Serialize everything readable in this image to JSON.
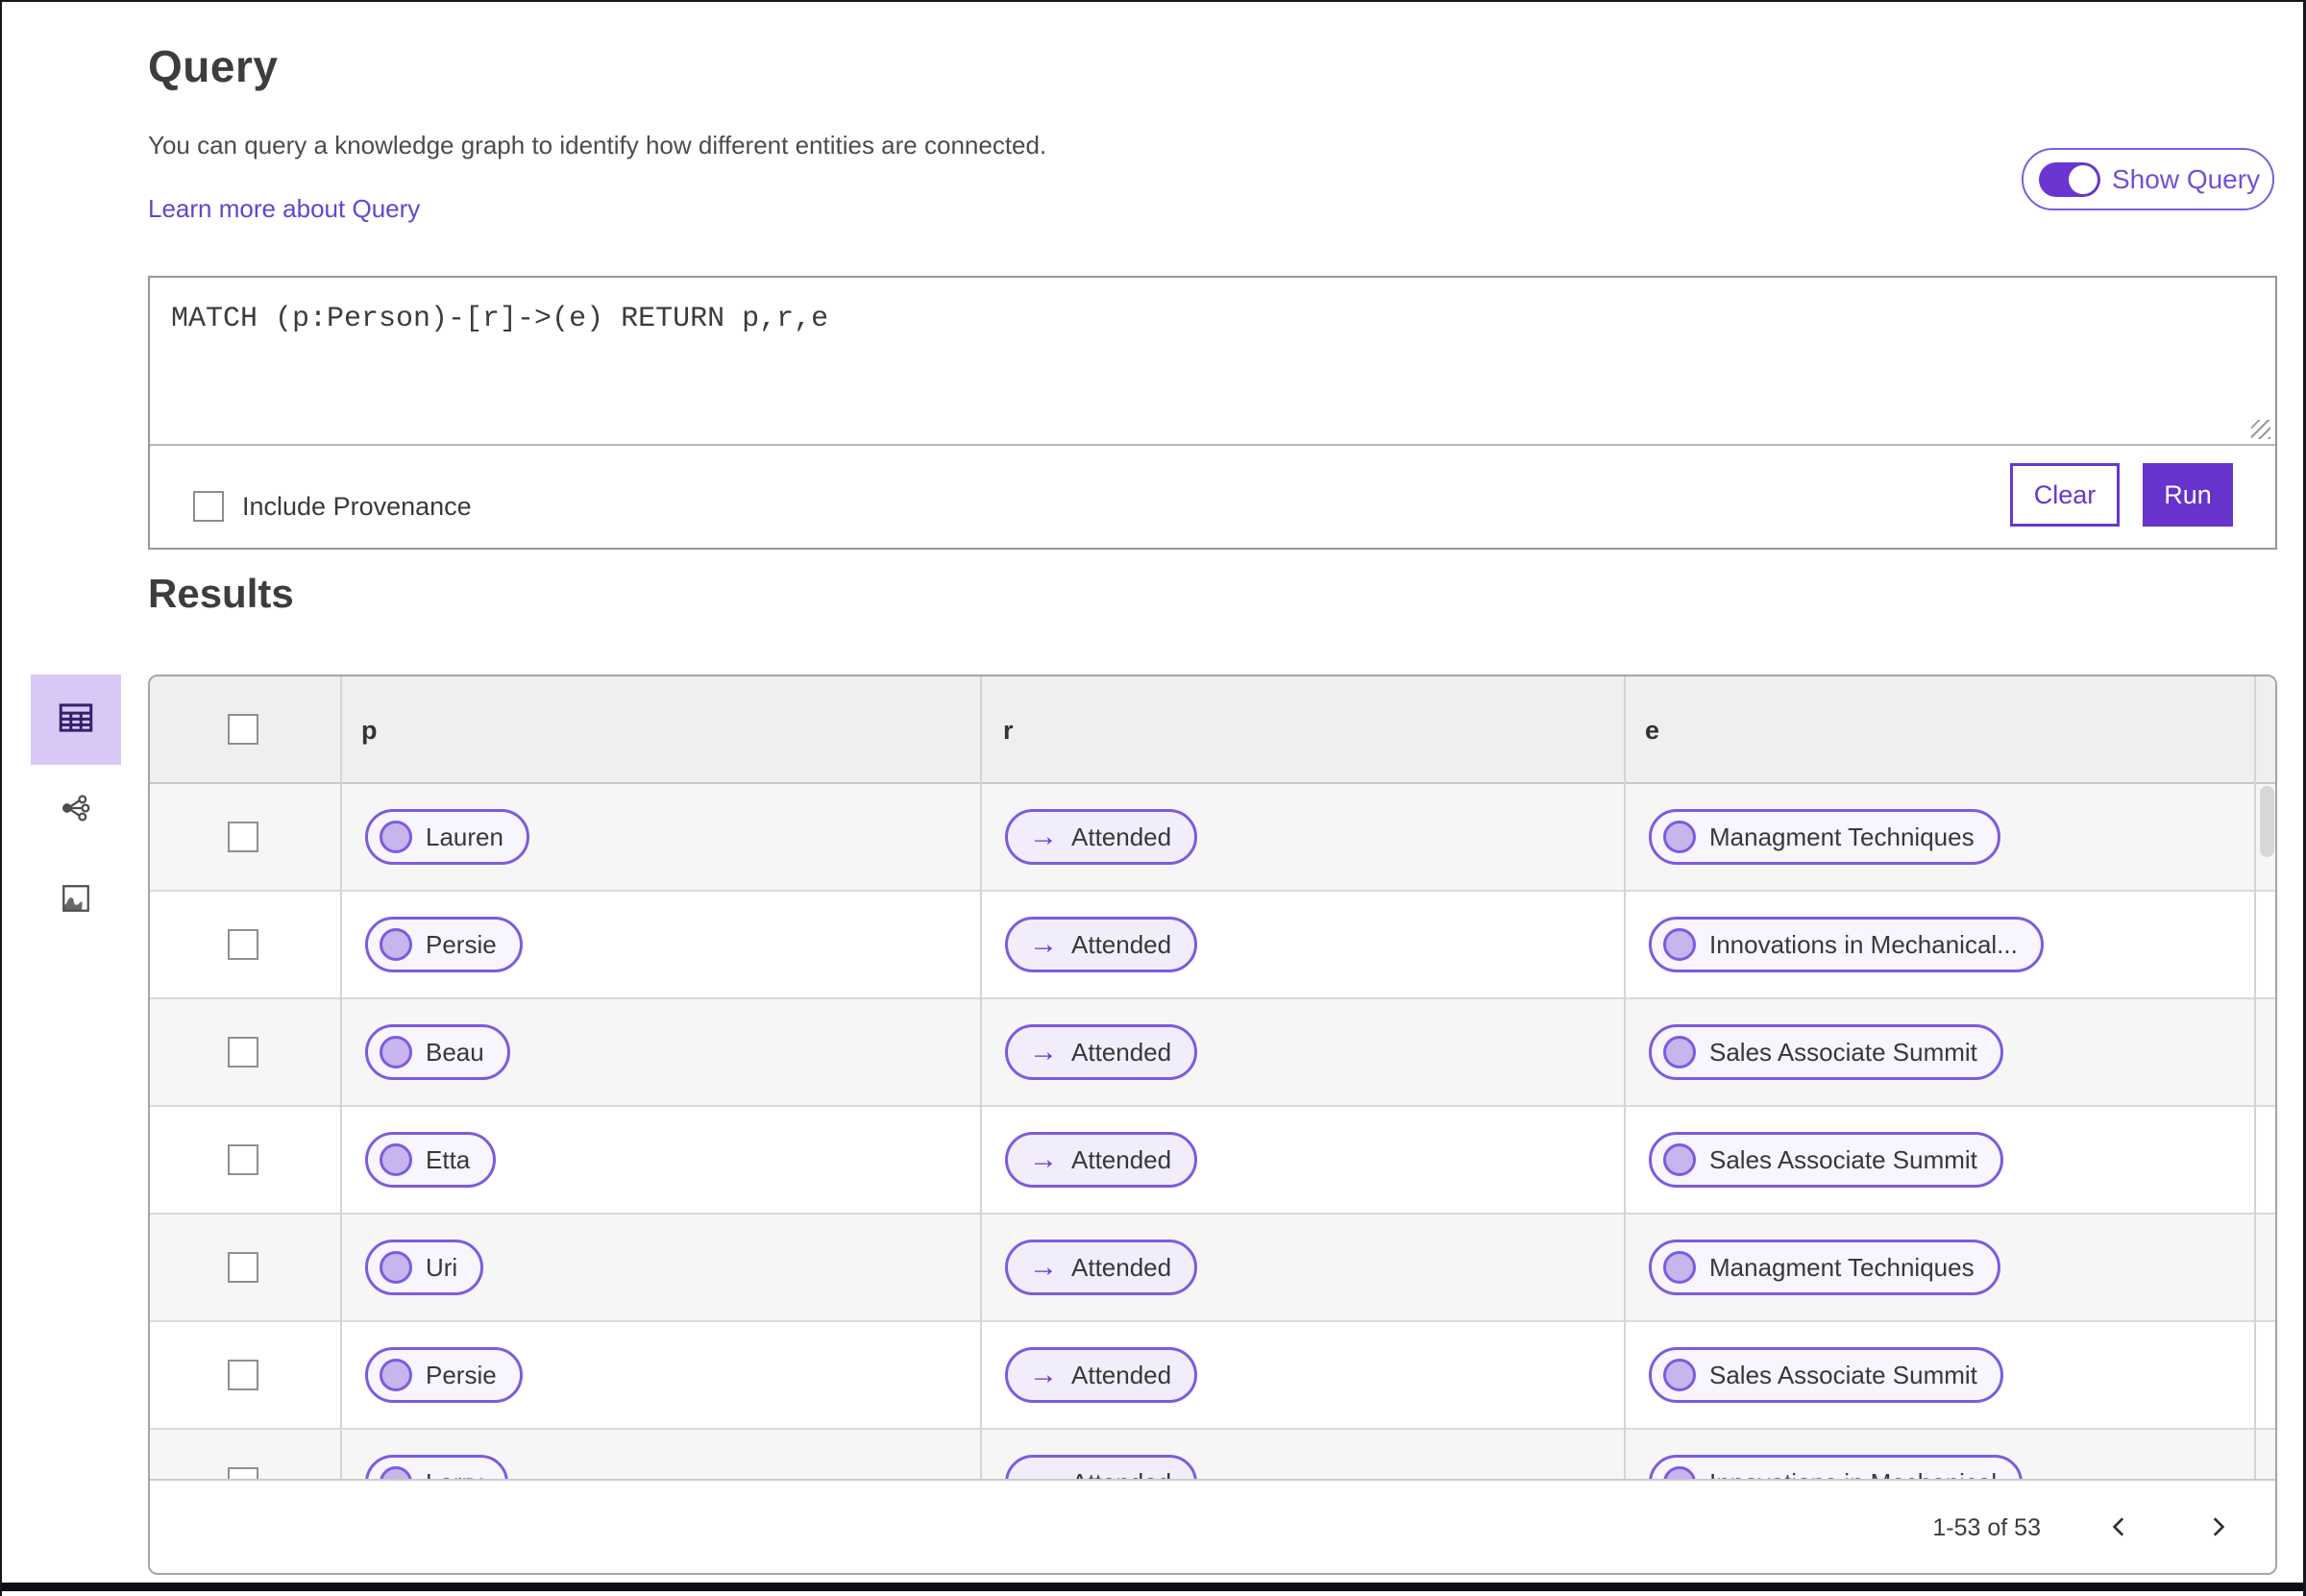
{
  "header": {
    "title": "Query",
    "description": "You can query a knowledge graph to identify how different entities are connected.",
    "learn_more_link": "Learn more about Query",
    "show_query_toggle": {
      "label": "Show Query",
      "state": "on"
    }
  },
  "query_editor": {
    "value": "MATCH (p:Person)-[r]->(e) RETURN p,r,e",
    "include_provenance_label": "Include Provenance",
    "include_provenance_checked": false,
    "clear_button": "Clear",
    "run_button": "Run"
  },
  "results": {
    "title": "Results",
    "view_switcher": [
      {
        "name": "table-view",
        "icon": "table-grid-icon",
        "selected": true
      },
      {
        "name": "graph-view",
        "icon": "share-nodes-icon",
        "selected": false
      },
      {
        "name": "map-view",
        "icon": "map-region-icon",
        "selected": false
      }
    ],
    "table": {
      "columns": [
        "p",
        "r",
        "e"
      ],
      "relation_arrow_glyph": "→",
      "rows": [
        {
          "p": "Lauren",
          "r": "Attended",
          "e": "Managment Techniques"
        },
        {
          "p": "Persie",
          "r": "Attended",
          "e": "Innovations in Mechanical..."
        },
        {
          "p": "Beau",
          "r": "Attended",
          "e": "Sales Associate Summit"
        },
        {
          "p": "Etta",
          "r": "Attended",
          "e": "Sales Associate Summit"
        },
        {
          "p": "Uri",
          "r": "Attended",
          "e": "Managment Techniques"
        },
        {
          "p": "Persie",
          "r": "Attended",
          "e": "Sales Associate Summit"
        },
        {
          "p": "Larry",
          "r": "Attended",
          "e": "Innovations in Mechanical"
        }
      ],
      "pagination": {
        "range_label": "1-53 of 53",
        "prev_icon": "chevron-left-icon",
        "next_icon": "chevron-right-icon"
      }
    }
  },
  "colors": {
    "accent_purple": "#6633cc",
    "pill_border_purple": "#7d5be0",
    "pill_circle_fill": "#c7b5ee",
    "selected_view_bg": "#d9c8f6",
    "link_purple": "#5c49cf"
  }
}
